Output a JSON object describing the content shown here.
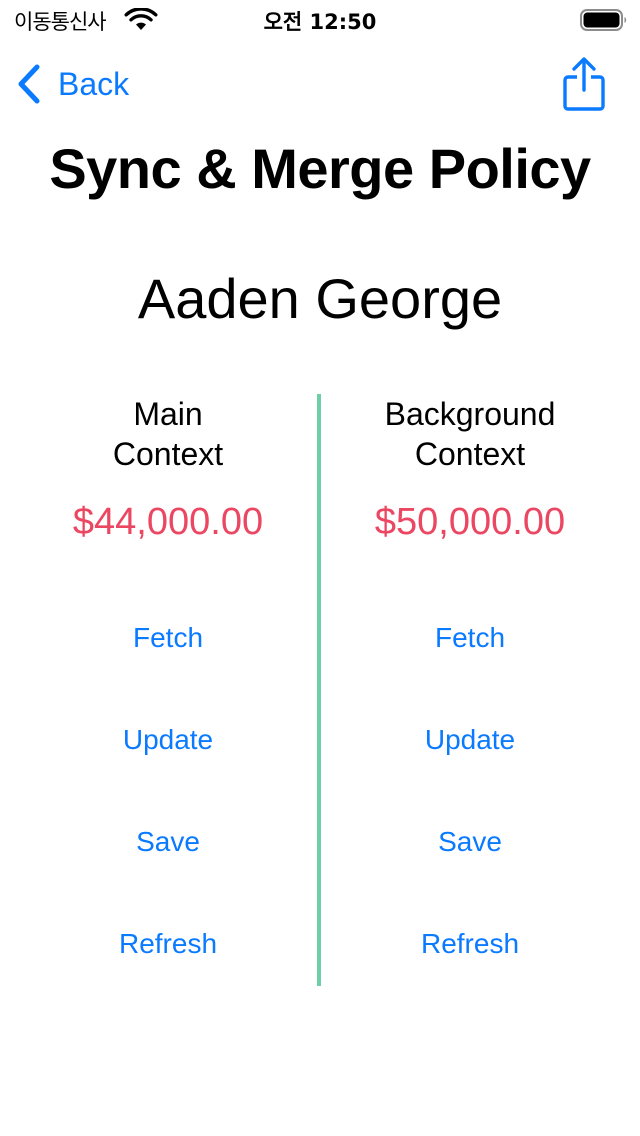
{
  "status_bar": {
    "carrier": "이동통신사",
    "time": "오전 12:50"
  },
  "nav": {
    "back_label": "Back",
    "share_icon": "share-icon"
  },
  "title": "Sync & Merge Policy",
  "person_name": "Aaden George",
  "columns": [
    {
      "title": "Main\nContext",
      "amount": "$44,000.00",
      "actions": [
        "Fetch",
        "Update",
        "Save",
        "Refresh"
      ]
    },
    {
      "title": "Background\nContext",
      "amount": "$50,000.00",
      "actions": [
        "Fetch",
        "Update",
        "Save",
        "Refresh"
      ]
    }
  ],
  "colors": {
    "accent": "#0a7aff",
    "amount": "#ec4762",
    "divider": "#6ccfa6"
  }
}
